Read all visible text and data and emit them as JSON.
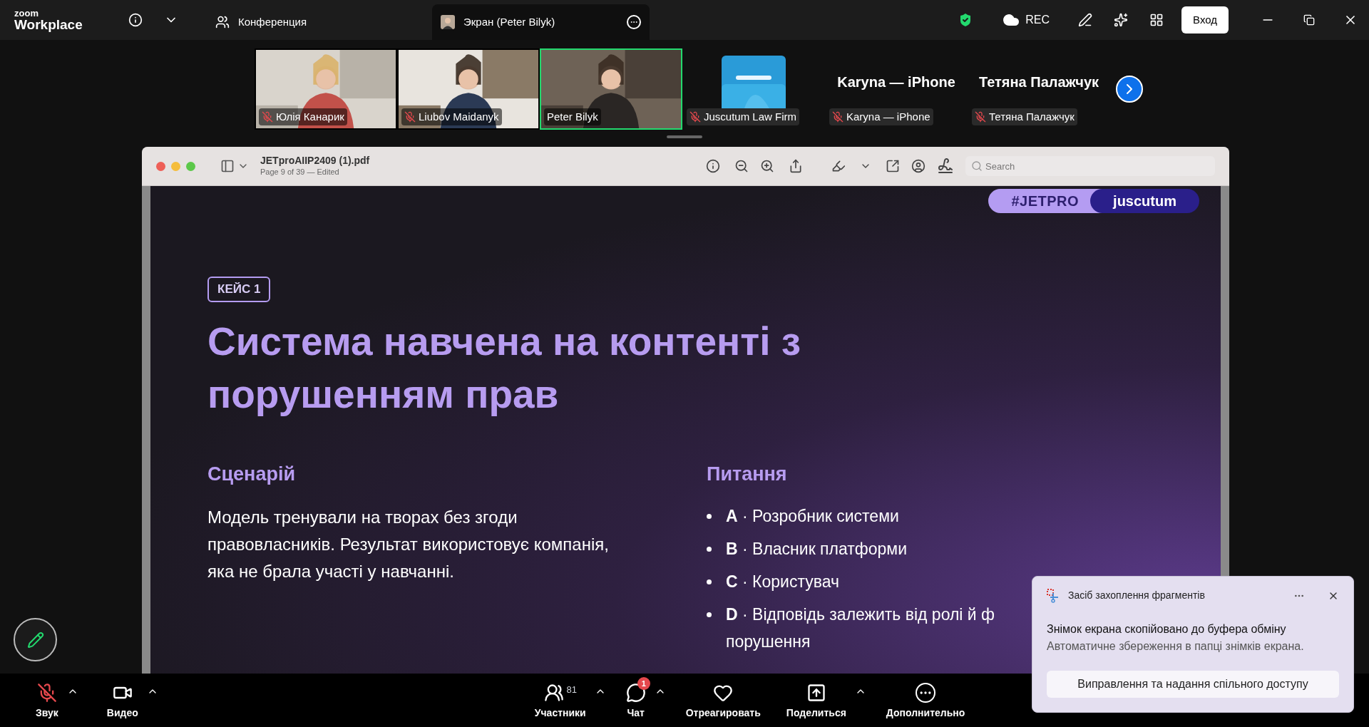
{
  "top_bar": {
    "logo_small": "zoom",
    "logo_big": "Workplace",
    "tabs": [
      {
        "label": "Конференция",
        "kind": "meeting",
        "selected": false
      },
      {
        "label": "Экран (Peter Bilyk)",
        "kind": "share",
        "selected": true
      }
    ],
    "rec": "REC",
    "login": "Вход"
  },
  "participants": [
    {
      "name": "Юлія Канарик",
      "kind": "video",
      "muted": true,
      "speaking": false
    },
    {
      "name": "Liubov Maidanyk",
      "kind": "video",
      "muted": true,
      "speaking": false
    },
    {
      "name": "Peter Bilyk",
      "kind": "video",
      "muted": false,
      "speaking": true
    },
    {
      "name": "Juscutum Law Firm",
      "kind": "avatar",
      "muted": true,
      "speaking": false
    },
    {
      "name": "Karyna — iPhone",
      "kind": "name",
      "title": "Karyna — iPhone",
      "muted": true,
      "speaking": false
    },
    {
      "name": "Тетяна Палажчук",
      "kind": "name",
      "title": "Тетяна Палажчук",
      "muted": true,
      "speaking": false
    }
  ],
  "pdf": {
    "title": "JETproAIIP2409 (1).pdf",
    "subtitle": "Page 9 of 39 — Edited",
    "search_placeholder": "Search"
  },
  "slide": {
    "tags": [
      "#JETPRO",
      "juscutum"
    ],
    "badge": "КЕЙС 1",
    "title": "Система навчена на контенті з порушенням прав",
    "left": {
      "heading": "Сценарій",
      "text": "Модель тренували на творах без згоди правовласників. Результат використовує компанія, яка не брала участі у навчанні."
    },
    "right": {
      "heading": "Питання",
      "items": [
        {
          "letter": "A",
          "text": "· Розробник системи"
        },
        {
          "letter": "B",
          "text": "· Власник платформи"
        },
        {
          "letter": "C",
          "text": "· Користувач"
        },
        {
          "letter": "D",
          "text": "· Відповідь залежить від ролі й ф",
          "continuation": "порушення"
        }
      ]
    }
  },
  "toolbar": [
    {
      "label": "Звук",
      "kind": "mic",
      "muted": true,
      "caret": true
    },
    {
      "label": "Видео",
      "kind": "video",
      "caret": true
    },
    {
      "label": "Участники",
      "kind": "participants",
      "count": "81",
      "caret": true
    },
    {
      "label": "Чат",
      "kind": "chat",
      "badge": "1",
      "caret": true
    },
    {
      "label": "Отреагировать",
      "kind": "react",
      "caret": false
    },
    {
      "label": "Поделиться",
      "kind": "share",
      "caret": true
    },
    {
      "label": "Дополнительно",
      "kind": "more",
      "caret": false
    }
  ],
  "notification": {
    "app": "Засіб захоплення фрагментів",
    "title": "Знімок екрана скопійовано до буфера обміну",
    "body": "Автоматичне збереження в папці знімків екрана.",
    "action": "Виправлення та надання спільного доступу"
  }
}
